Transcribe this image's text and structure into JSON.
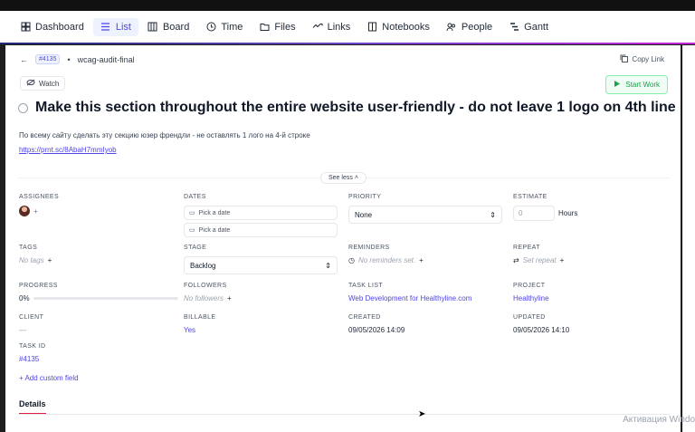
{
  "nav": {
    "tabs": [
      {
        "label": "Dashboard",
        "icon": "dashboard-icon"
      },
      {
        "label": "List",
        "icon": "list-icon"
      },
      {
        "label": "Board",
        "icon": "board-icon"
      },
      {
        "label": "Time",
        "icon": "clock-icon"
      },
      {
        "label": "Files",
        "icon": "folder-icon"
      },
      {
        "label": "Links",
        "icon": "link-icon"
      },
      {
        "label": "Notebooks",
        "icon": "notebook-icon"
      },
      {
        "label": "People",
        "icon": "people-icon"
      },
      {
        "label": "Gantt",
        "icon": "gantt-icon"
      }
    ],
    "active": "List"
  },
  "task": {
    "id_badge": "#4135",
    "slug": "wcag-audit-final",
    "copy_link": "Copy Link",
    "watch": "Watch",
    "start_work": "Start Work",
    "title": "Make this section throughout the entire website user-friendly - do not leave 1 logo on 4th line",
    "description": "По всему сайту сделать эту секцию юзер френдли - не оставлять 1 лого на 4-й строке",
    "link": "https://prnt.sc/8AbaH7mmIyob",
    "see_less": "See less"
  },
  "fields": {
    "assignees": {
      "label": "ASSIGNEES",
      "add": "+"
    },
    "dates": {
      "label": "DATES",
      "start_placeholder": "Pick a date",
      "end_placeholder": "Pick a date"
    },
    "priority": {
      "label": "PRIORITY",
      "value": "None"
    },
    "estimate": {
      "label": "ESTIMATE",
      "value": "0",
      "unit": "Hours"
    },
    "tags": {
      "label": "TAGS",
      "value": "No tags",
      "add": "+"
    },
    "stage": {
      "label": "STAGE",
      "value": "Backlog"
    },
    "reminders": {
      "label": "REMINDERS",
      "value": "No reminders set.",
      "add": "+"
    },
    "repeat": {
      "label": "REPEAT",
      "value": "Set repeat",
      "add": "+"
    },
    "progress": {
      "label": "PROGRESS",
      "value": "0%",
      "fraction": 0
    },
    "followers": {
      "label": "FOLLOWERS",
      "value": "No followers",
      "add": "+"
    },
    "task_list": {
      "label": "TASK LIST",
      "value": "Web Development for Healthyline.com"
    },
    "project": {
      "label": "PROJECT",
      "value": "Healthyline"
    },
    "client": {
      "label": "CLIENT",
      "value": "—"
    },
    "billable": {
      "label": "BILLABLE",
      "value": "Yes"
    },
    "created": {
      "label": "CREATED",
      "value": "09/05/2026 14:09"
    },
    "updated": {
      "label": "UPDATED",
      "value": "09/05/2026 14:10"
    },
    "task_id": {
      "label": "TASK ID",
      "value": "#4135"
    }
  },
  "add_custom_field": "Add custom field",
  "details_tab": "Details",
  "watermark": "Активация Windo"
}
